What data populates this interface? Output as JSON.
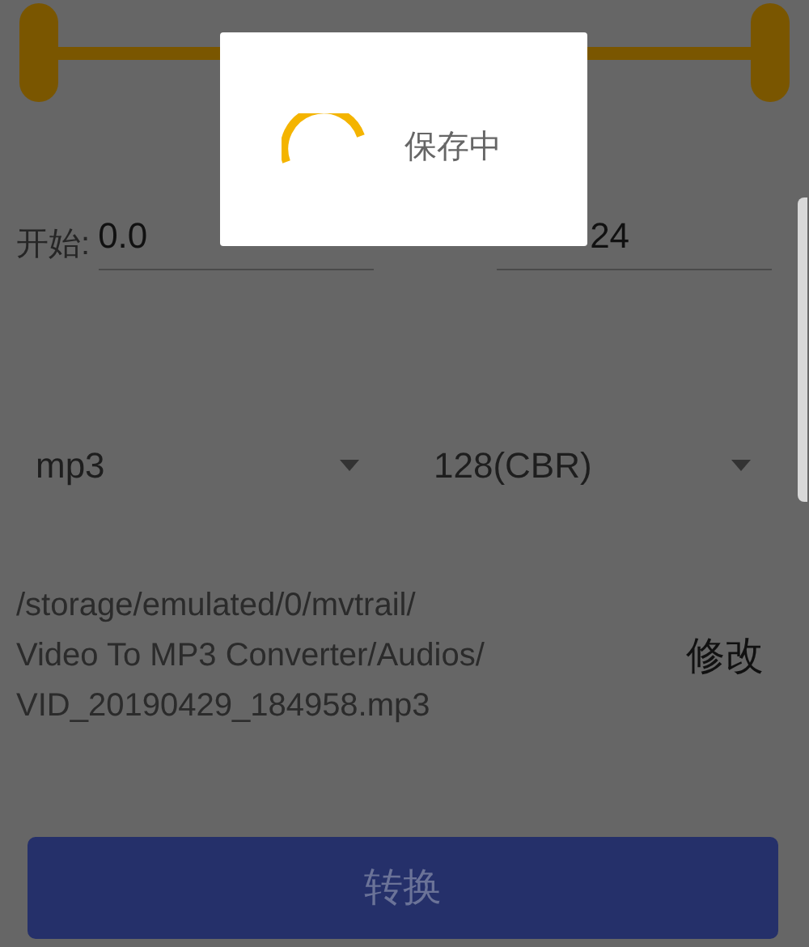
{
  "range": {
    "low_thumb": {
      "level": 0
    },
    "high_thumb": {
      "level": 1
    },
    "start_label": "开始:",
    "start_value": "0.0",
    "end_value_visible": "24"
  },
  "format": {
    "value": "mp3"
  },
  "bitrate": {
    "value": "128(CBR)"
  },
  "output_path": {
    "lines": [
      "/storage/emulated/0/mvtrail/",
      "Video To MP3 Converter/Audios/",
      "VID_20190429_184958.mp3"
    ],
    "edit_label": "修改"
  },
  "convert_button": {
    "label": "转换"
  },
  "dialog": {
    "message": "保存中"
  }
}
